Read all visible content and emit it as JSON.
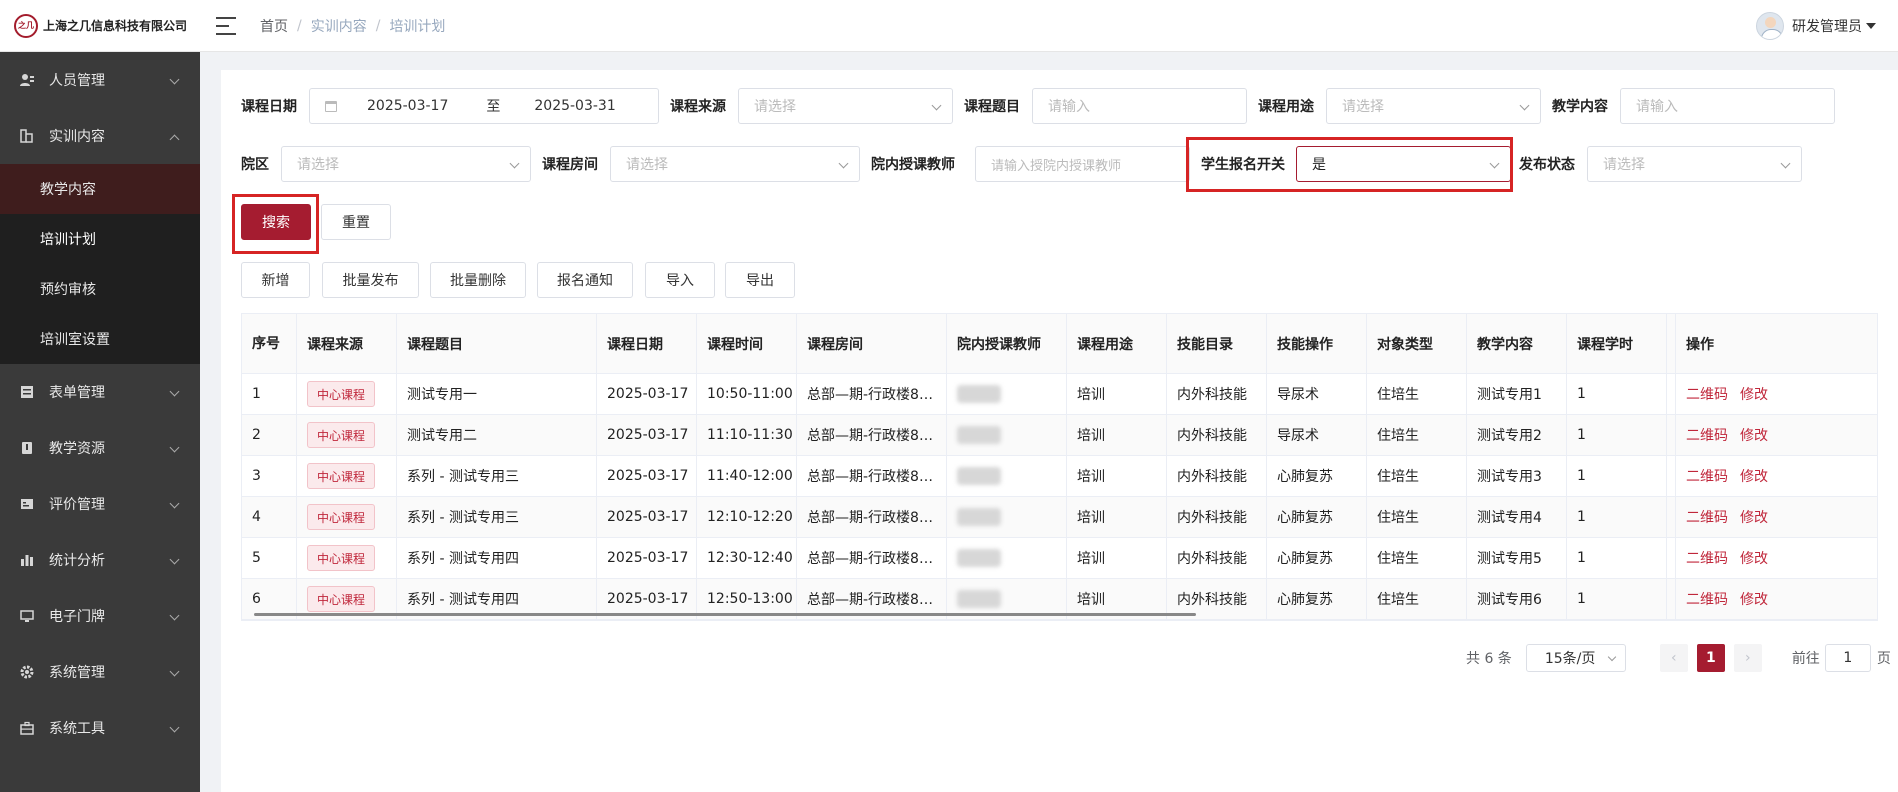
{
  "header": {
    "company": "上海之几信息科技有限公司",
    "logo_mark": "之几",
    "breadcrumb": [
      "首页",
      "实训内容",
      "培训计划"
    ],
    "user_name": "研发管理员"
  },
  "sidebar": {
    "items": [
      {
        "label": "人员管理",
        "icon": "users-icon"
      },
      {
        "label": "实训内容",
        "icon": "training-icon",
        "expanded": true,
        "children": [
          "教学内容",
          "培训计划",
          "预约审核",
          "培训室设置"
        ]
      },
      {
        "label": "表单管理",
        "icon": "form-icon"
      },
      {
        "label": "教学资源",
        "icon": "book-icon"
      },
      {
        "label": "评价管理",
        "icon": "rating-icon"
      },
      {
        "label": "统计分析",
        "icon": "bar-chart-icon"
      },
      {
        "label": "电子门牌",
        "icon": "monitor-icon"
      },
      {
        "label": "系统管理",
        "icon": "gear-icon"
      },
      {
        "label": "系统工具",
        "icon": "toolbox-icon"
      }
    ]
  },
  "filters": {
    "course_date_label": "课程日期",
    "date_start": "2025-03-17",
    "date_to": "至",
    "date_end": "2025-03-31",
    "course_source_label": "课程来源",
    "course_source_ph": "请选择",
    "course_title_label": "课程题目",
    "course_title_ph": "请输入",
    "course_use_label": "课程用途",
    "course_use_ph": "请选择",
    "teach_content_label": "教学内容",
    "teach_content_ph": "请输入",
    "campus_label": "院区",
    "campus_ph": "请选择",
    "room_label": "课程房间",
    "room_ph": "请选择",
    "teacher_label": "院内授课教师",
    "teacher_ph": "请输入授院内授课教师",
    "signup_label": "学生报名开关",
    "signup_value": "是",
    "publish_label": "发布状态",
    "publish_ph": "请选择",
    "search": "搜索",
    "reset": "重置"
  },
  "toolbar": {
    "add": "新增",
    "batch_publish": "批量发布",
    "batch_delete": "批量删除",
    "signup_notice": "报名通知",
    "import": "导入",
    "export": "导出"
  },
  "table": {
    "columns": [
      "序号",
      "课程来源",
      "课程题目",
      "课程日期",
      "课程时间",
      "课程房间",
      "院内授课教师",
      "课程用途",
      "技能目录",
      "技能操作",
      "对象类型",
      "教学内容",
      "课程学时",
      "操作"
    ],
    "rows": [
      {
        "no": "1",
        "source": "中心课程",
        "title": "测试专用一",
        "date": "2025-03-17",
        "time": "10:50-11:00",
        "room": "总部—期-行政楼8…",
        "use": "培训",
        "skill_dir": "内外科技能",
        "skill_op": "导尿术",
        "target": "住培生",
        "content": "测试专用1",
        "hours": "1"
      },
      {
        "no": "2",
        "source": "中心课程",
        "title": "测试专用二",
        "date": "2025-03-17",
        "time": "11:10-11:30",
        "room": "总部—期-行政楼8…",
        "use": "培训",
        "skill_dir": "内外科技能",
        "skill_op": "导尿术",
        "target": "住培生",
        "content": "测试专用2",
        "hours": "1"
      },
      {
        "no": "3",
        "source": "中心课程",
        "title": "系列 - 测试专用三",
        "date": "2025-03-17",
        "time": "11:40-12:00",
        "room": "总部—期-行政楼8…",
        "use": "培训",
        "skill_dir": "内外科技能",
        "skill_op": "心肺复苏",
        "target": "住培生",
        "content": "测试专用3",
        "hours": "1"
      },
      {
        "no": "4",
        "source": "中心课程",
        "title": "系列 - 测试专用三",
        "date": "2025-03-17",
        "time": "12:10-12:20",
        "room": "总部—期-行政楼8…",
        "use": "培训",
        "skill_dir": "内外科技能",
        "skill_op": "心肺复苏",
        "target": "住培生",
        "content": "测试专用4",
        "hours": "1"
      },
      {
        "no": "5",
        "source": "中心课程",
        "title": "系列 - 测试专用四",
        "date": "2025-03-17",
        "time": "12:30-12:40",
        "room": "总部—期-行政楼8…",
        "use": "培训",
        "skill_dir": "内外科技能",
        "skill_op": "心肺复苏",
        "target": "住培生",
        "content": "测试专用5",
        "hours": "1"
      },
      {
        "no": "6",
        "source": "中心课程",
        "title": "系列 - 测试专用四",
        "date": "2025-03-17",
        "time": "12:50-13:00",
        "room": "总部—期-行政楼8…",
        "use": "培训",
        "skill_dir": "内外科技能",
        "skill_op": "心肺复苏",
        "target": "住培生",
        "content": "测试专用6",
        "hours": "1"
      }
    ],
    "op_qr": "二维码",
    "op_edit": "修改"
  },
  "pagination": {
    "total": "共 6 条",
    "page_size": "15条/页",
    "current": "1",
    "goto_label": "前往",
    "goto_value": "1",
    "page_unit": "页"
  },
  "colors": {
    "accent": "#a51c30",
    "highlight": "#d62424",
    "sidebar": "#3a3a3a"
  }
}
